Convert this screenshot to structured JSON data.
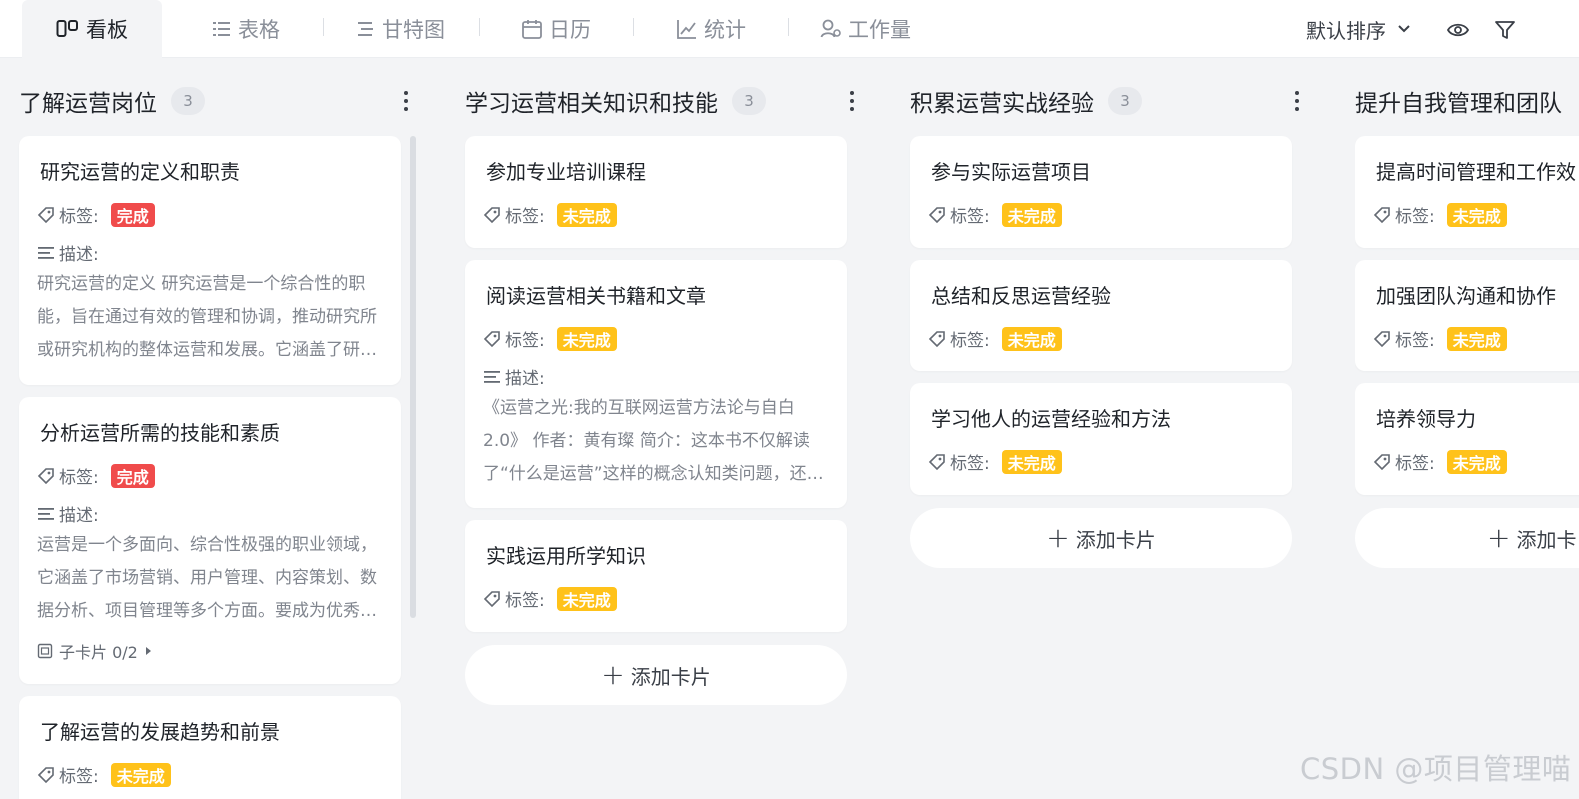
{
  "colors": {
    "accent": "#f04b4b",
    "done": "#f04b4b",
    "todo": "#ffc21a",
    "board_bg": "#f3f4f6"
  },
  "view_tabs": [
    {
      "label": "看板",
      "icon": "kanban-icon",
      "active": true
    },
    {
      "label": "表格",
      "icon": "list-icon",
      "active": false
    },
    {
      "label": "甘特图",
      "icon": "gantt-icon",
      "active": false
    },
    {
      "label": "日历",
      "icon": "calendar-icon",
      "active": false
    },
    {
      "label": "统计",
      "icon": "chart-icon",
      "active": false
    },
    {
      "label": "工作量",
      "icon": "workload-icon",
      "active": false
    }
  ],
  "toolbar": {
    "sort_label": "默认排序",
    "view_icon": "eye-icon",
    "filter_icon": "filter-icon"
  },
  "labels": {
    "tag": "标签:",
    "description": "描述:",
    "add_card": "添加卡片"
  },
  "columns": [
    {
      "title": "了解运营岗位",
      "count": "3",
      "cards": [
        {
          "title": "研究运营的定义和职责",
          "tag": "完成",
          "status": "done",
          "description": "研究运营的定义 研究运营是一个综合性的职能，旨在通过有效的管理和协调，推动研究所或研究机构的整体运营和发展。它涵盖了研究项目管理、资源配置等多个方面"
        },
        {
          "title": "分析运营所需的技能和素质",
          "tag": "完成",
          "status": "done",
          "description": "运营是一个多面向、综合性极强的职业领域，它涵盖了市场营销、用户管理、内容策划、数据分析、项目管理等多个方面。要成为优秀的运营人员需要具备多种技能",
          "subcards": "子卡片 0/2"
        },
        {
          "title": "了解运营的发展趋势和前景",
          "tag": "未完成",
          "status": "todo"
        }
      ]
    },
    {
      "title": "学习运营相关知识和技能",
      "count": "3",
      "cards": [
        {
          "title": "参加专业培训课程",
          "tag": "未完成",
          "status": "todo"
        },
        {
          "title": "阅读运营相关书籍和文章",
          "tag": "未完成",
          "status": "todo",
          "description": "《运营之光:我的互联网运营方法论与自白2.0》 作者：黄有璨 简介：这本书不仅解读了“什么是运营”这样的概念认知类问题，还分享了大量实战经验"
        },
        {
          "title": "实践运用所学知识",
          "tag": "未完成",
          "status": "todo"
        }
      ]
    },
    {
      "title": "积累运营实战经验",
      "count": "3",
      "cards": [
        {
          "title": "参与实际运营项目",
          "tag": "未完成",
          "status": "todo"
        },
        {
          "title": "总结和反思运营经验",
          "tag": "未完成",
          "status": "todo"
        },
        {
          "title": "学习他人的运营经验和方法",
          "tag": "未完成",
          "status": "todo"
        }
      ]
    },
    {
      "title": "提升自我管理和团队",
      "cards": [
        {
          "title": "提高时间管理和工作效",
          "tag": "未完成",
          "status": "todo"
        },
        {
          "title": "加强团队沟通和协作",
          "tag": "未完成",
          "status": "todo"
        },
        {
          "title": "培养领导力",
          "tag": "未完成",
          "status": "todo"
        }
      ],
      "add_card_partial": "添加卡"
    }
  ],
  "watermark": "CSDN @项目管理喵"
}
